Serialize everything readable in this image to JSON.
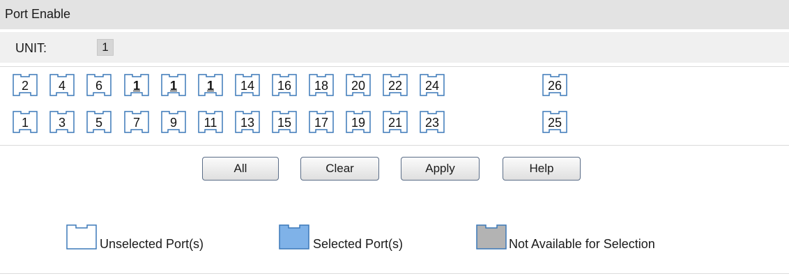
{
  "panel": {
    "title": "Port Enable"
  },
  "unit": {
    "label": "UNIT:",
    "value": "1"
  },
  "ports": {
    "top_row": [
      {
        "label": "2",
        "highlight": false
      },
      {
        "label": "4",
        "highlight": false
      },
      {
        "label": "6",
        "highlight": false
      },
      {
        "label": "1",
        "highlight": true
      },
      {
        "label": "1",
        "highlight": true
      },
      {
        "label": "1",
        "highlight": true
      },
      {
        "label": "14",
        "highlight": false
      },
      {
        "label": "16",
        "highlight": false
      },
      {
        "label": "18",
        "highlight": false
      },
      {
        "label": "20",
        "highlight": false
      },
      {
        "label": "22",
        "highlight": false
      },
      {
        "label": "24",
        "highlight": false
      },
      {
        "label": "26",
        "highlight": false
      }
    ],
    "bottom_row": [
      {
        "label": "1",
        "highlight": false
      },
      {
        "label": "3",
        "highlight": false
      },
      {
        "label": "5",
        "highlight": false
      },
      {
        "label": "7",
        "highlight": false
      },
      {
        "label": "9",
        "highlight": false
      },
      {
        "label": "11",
        "highlight": false
      },
      {
        "label": "13",
        "highlight": false
      },
      {
        "label": "15",
        "highlight": false
      },
      {
        "label": "17",
        "highlight": false
      },
      {
        "label": "19",
        "highlight": false
      },
      {
        "label": "21",
        "highlight": false
      },
      {
        "label": "23",
        "highlight": false
      },
      {
        "label": "25",
        "highlight": false
      }
    ]
  },
  "buttons": {
    "all": "All",
    "clear": "Clear",
    "apply": "Apply",
    "help": "Help"
  },
  "legend": {
    "unselected": "Unselected Port(s)",
    "selected": "Selected Port(s)",
    "unavailable": "Not Available for Selection"
  },
  "colors": {
    "port_outline": "#3b78b8",
    "selected_fill": "#7fb2e8",
    "unavailable_fill": "#b3b3b3"
  }
}
